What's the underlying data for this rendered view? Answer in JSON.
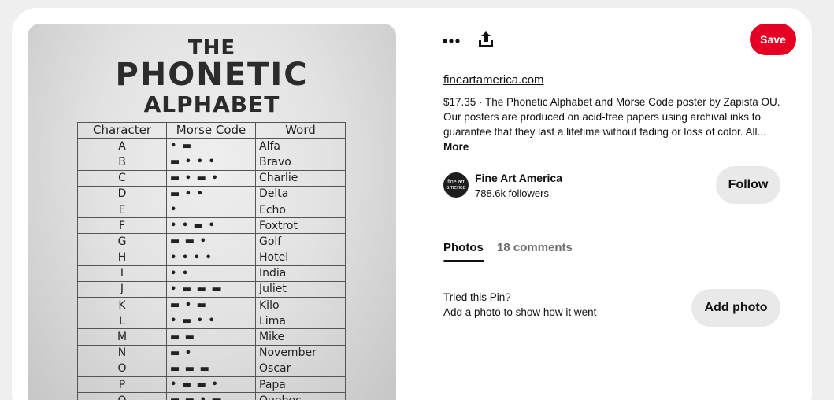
{
  "pin": {
    "poster": {
      "title_line1": "THE",
      "title_line2": "PHONETIC",
      "title_line3": "ALPHABET",
      "headers": [
        "Character",
        "Morse Code",
        "Word"
      ],
      "rows": [
        [
          "A",
          "• ▬",
          "Alfa"
        ],
        [
          "B",
          "▬ • • •",
          "Bravo"
        ],
        [
          "C",
          "▬ • ▬ •",
          "Charlie"
        ],
        [
          "D",
          "▬ • •",
          "Delta"
        ],
        [
          "E",
          "•",
          "Echo"
        ],
        [
          "F",
          "• • ▬ •",
          "Foxtrot"
        ],
        [
          "G",
          "▬ ▬ •",
          "Golf"
        ],
        [
          "H",
          "• • • •",
          "Hotel"
        ],
        [
          "I",
          "• •",
          "India"
        ],
        [
          "J",
          "• ▬ ▬ ▬",
          "Juliet"
        ],
        [
          "K",
          "▬ • ▬",
          "Kilo"
        ],
        [
          "L",
          "• ▬ • •",
          "Lima"
        ],
        [
          "M",
          "▬ ▬",
          "Mike"
        ],
        [
          "N",
          "▬ •",
          "November"
        ],
        [
          "O",
          "▬ ▬ ▬",
          "Oscar"
        ],
        [
          "P",
          "• ▬ ▬ •",
          "Papa"
        ],
        [
          "Q",
          "▬ ▬ • ▬",
          "Quebec"
        ]
      ]
    }
  },
  "toolbar": {
    "more_icon": "ellipsis-icon",
    "share_icon": "share-upload-icon",
    "save_label": "Save",
    "save_color": "#e60023"
  },
  "source": {
    "domain": "fineartamerica.com"
  },
  "description": {
    "text": "$17.35 · The Phonetic Alphabet and Morse Code poster by Zapista OU. Our posters are produced on acid-free papers using archival inks to guarantee that they last a lifetime without fading or loss of color. All...",
    "more_label": "More"
  },
  "creator": {
    "avatar_line1": "fine art",
    "avatar_line2": "america",
    "name": "Fine Art America",
    "followers": "788.6k followers",
    "follow_label": "Follow"
  },
  "tabs": {
    "photos": "Photos",
    "comments": "18 comments"
  },
  "tried": {
    "title": "Tried this Pin?",
    "subtitle": "Add a photo to show how it went",
    "add_photo_label": "Add photo"
  }
}
